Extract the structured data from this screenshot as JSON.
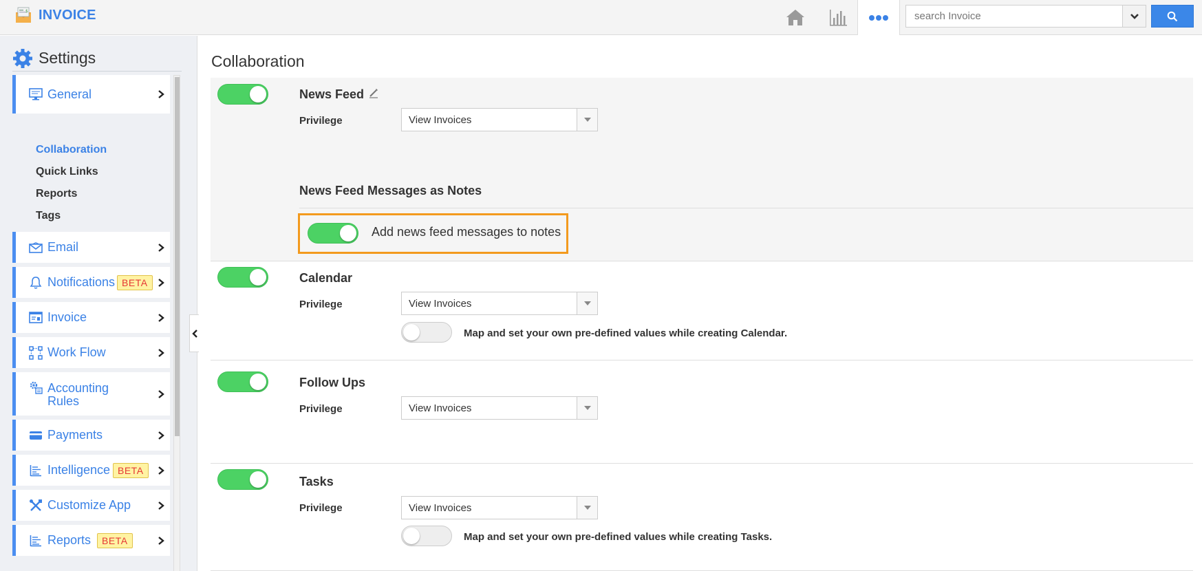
{
  "app": {
    "title": "INVOICE"
  },
  "topbar": {
    "home_icon": "home-icon",
    "analytics_icon": "bar-chart-icon",
    "more_icon": "more-dots-icon",
    "search_placeholder": "search Invoice",
    "accent": "#3b87e8"
  },
  "sidebar": {
    "title": "Settings",
    "items": [
      {
        "label": "General",
        "icon": "monitor-icon"
      },
      {
        "label": "Email",
        "icon": "envelope-icon"
      },
      {
        "label": "Notifications",
        "icon": "bell-icon",
        "badge": "BETA"
      },
      {
        "label": "Invoice",
        "icon": "invoice-icon"
      },
      {
        "label": "Work Flow",
        "icon": "workflow-icon"
      },
      {
        "label": "Accounting",
        "label2": "Rules",
        "icon": "gear-rules-icon"
      },
      {
        "label": "Payments",
        "icon": "credit-card-icon"
      },
      {
        "label": "Intelligence",
        "icon": "report-lines-icon",
        "badge": "BETA"
      },
      {
        "label": "Customize App",
        "icon": "tools-icon"
      },
      {
        "label": "Reports",
        "icon": "report-lines-icon",
        "badge": "BETA"
      }
    ],
    "subitems": [
      "Collaboration",
      "Quick Links",
      "Reports",
      "Tags"
    ]
  },
  "main": {
    "title": "Collaboration",
    "news_feed": {
      "title": "News Feed",
      "enabled": true,
      "privilege_label": "Privilege",
      "privilege_value": "View Invoices",
      "notes_heading": "News Feed Messages as Notes",
      "notes_toggle_label": "Add news feed messages to notes",
      "notes_enabled": true
    },
    "calendar": {
      "title": "Calendar",
      "enabled": true,
      "privilege_label": "Privilege",
      "privilege_value": "View Invoices",
      "map_text": "Map and set your own pre-defined values while creating Calendar.",
      "map_enabled": false
    },
    "follow_ups": {
      "title": "Follow Ups",
      "enabled": true,
      "privilege_label": "Privilege",
      "privilege_value": "View Invoices"
    },
    "tasks": {
      "title": "Tasks",
      "enabled": true,
      "privilege_label": "Privilege",
      "privilege_value": "View Invoices",
      "map_text": "Map and set your own pre-defined values while creating Tasks.",
      "map_enabled": false
    }
  },
  "colors": {
    "toggle_on": "#4cd264",
    "highlight": "#f39a1e",
    "beta_bg": "#fff3a3",
    "beta_text": "#e53935"
  }
}
